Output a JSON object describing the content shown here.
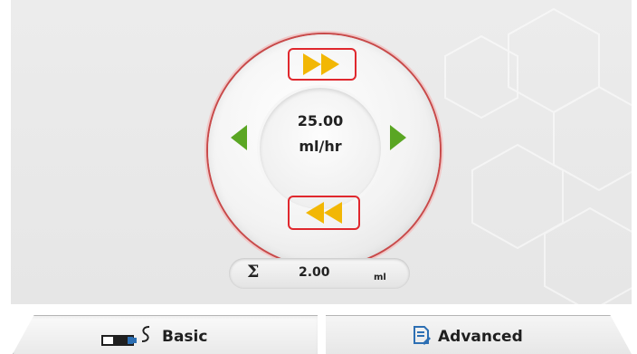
{
  "pump": {
    "rate_value": "25.00",
    "rate_unit": "ml/hr",
    "increase_icon": "fast-forward-icon",
    "decrease_icon": "fast-rewind-icon",
    "left_icon": "triangle-left-icon",
    "right_icon": "triangle-right-icon"
  },
  "total": {
    "symbol": "Σ",
    "value": "2.00",
    "unit": "ml"
  },
  "tabs": [
    {
      "label": "Basic",
      "icon": "syringe-icon",
      "active": true
    },
    {
      "label": "Advanced",
      "icon": "document-edit-icon",
      "active": false
    }
  ],
  "colors": {
    "highlight_border": "#e0282e",
    "dial_ring": "#c84a4a",
    "arrow_yellow": "#f2b705",
    "arrow_green": "#5aa623",
    "icon_blue": "#2d6fb3"
  }
}
